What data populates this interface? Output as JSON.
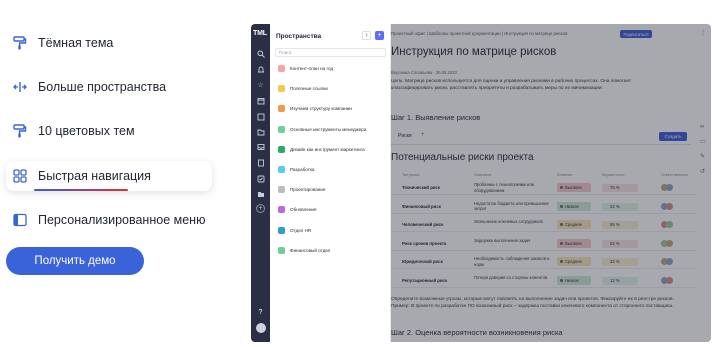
{
  "features": {
    "items": [
      {
        "label": "Тёмная тема",
        "icon": "paint-roller-icon"
      },
      {
        "label": "Больше пространства",
        "icon": "expand-horizontal-icon"
      },
      {
        "label": "10 цветовых тем",
        "icon": "paint-roller-icon"
      },
      {
        "label": "Быстрая навигация",
        "icon": "grid-icon",
        "active": true
      },
      {
        "label": "Персонализированное меню",
        "icon": "sidebar-layout-icon"
      }
    ]
  },
  "cta": {
    "label": "Получить демо"
  },
  "colors": {
    "brand": "#3b63d9",
    "rail": "#2a2f45",
    "underline_start": "#3b5bdb",
    "underline_end": "#e03131"
  },
  "app": {
    "logo": "TML",
    "rail_icons": [
      "search-icon",
      "bell-icon",
      "star-icon",
      "calendar-icon",
      "checkbox-icon",
      "folder-icon",
      "inbox-icon",
      "document-icon",
      "check-icon",
      "folder-open-icon",
      "plus-icon",
      "help-icon",
      "avatar"
    ],
    "help_glyph": "?",
    "panel": {
      "title": "Пространства",
      "add_glyph": "+",
      "search_placeholder": "Поиск",
      "spaces": [
        {
          "label": "Контент-план на год",
          "color": "#f4a6a6"
        },
        {
          "label": "Полезные ссылки",
          "color": "#f2c94c"
        },
        {
          "label": "Изучаем структуру компании",
          "color": "#f2994a"
        },
        {
          "label": "Основные инструменты менеджера",
          "color": "#6fcf97"
        },
        {
          "label": "Дизайн как инструмент маркетинга",
          "color": "#27ae60"
        },
        {
          "label": "Разработка",
          "color": "#56ccf2"
        },
        {
          "label": "Проектирование",
          "color": "#bdbdbd"
        },
        {
          "label": "Обновления",
          "color": "#bb6bd9"
        },
        {
          "label": "Отдел HR",
          "color": "#2d9cdb"
        },
        {
          "label": "Финансовый отдел",
          "color": "#6fcf97"
        }
      ]
    },
    "doc": {
      "breadcrumb": "Проектный офис  |  Шаблоны проектной документации  |  Инструкция по матрице рисков",
      "subscribe_label": "Подписаться",
      "title": "Инструкция по матрице рисков",
      "author": "Вероника Соловьева  ·  26.09.2023",
      "intro": "Цель: Матрица рисков используется для оценки и управления рисками в рабочих процессах. Она помогает классифицировать риски, расставлять приоритеты и разрабатывать меры по их минимизации.",
      "step1": "Шаг 1. Выявление рисков",
      "tab_label": "Риски",
      "tab_plus": "+",
      "create_label": "Создать",
      "table_title": "Потенциальные риски проекта",
      "columns": [
        "Тип риска",
        "Описание",
        "Влияние",
        "Вероятность",
        "Ответственные"
      ],
      "rows": [
        {
          "type": "Технический риск",
          "desc": "Проблемы с технологиями или оборудованием",
          "impact": "Высокое",
          "prob": "75 %",
          "impact_color": "#f8c9c9",
          "prob_color": "#fbe1e1"
        },
        {
          "type": "Финансовый риск",
          "desc": "Недостаток бюджета или превышение затрат",
          "impact": "Низкое",
          "prob": "22 %",
          "impact_color": "#cfe9d4",
          "prob_color": "#e2f3e5"
        },
        {
          "type": "Человеческий риск",
          "desc": "Увольнение ключевых сотрудников",
          "impact": "Среднее",
          "prob": "55 %",
          "impact_color": "#fbe6b8",
          "prob_color": "#fcefd1"
        },
        {
          "type": "Риск сроков проекта",
          "desc": "Задержка выполнения задач",
          "impact": "Высокое",
          "prob": "52 %",
          "impact_color": "#f8c9c9",
          "prob_color": "#fbe1e1"
        },
        {
          "type": "Юридический риск",
          "desc": "Необходимость соблюдения законов и норм",
          "impact": "Среднее",
          "prob": "32 %",
          "impact_color": "#fbe6b8",
          "prob_color": "#fcefd1"
        },
        {
          "type": "Репутационный риск",
          "desc": "Потеря доверия со стороны клиентов",
          "impact": "Низкое",
          "prob": "12 %",
          "impact_color": "#cfe9d4",
          "prob_color": "#e2f3e5"
        }
      ],
      "footer": "Определите возможные угрозы, которые могут повлиять на выполнение задач или проектов. Фиксируйте их в реестре рисков. Пример: В проекте по разработке ПО возможный риск – задержка поставки ключевого компонента от стороннего поставщика.",
      "step2": "Шаг 2. Оценка вероятности возникновения риска"
    }
  }
}
